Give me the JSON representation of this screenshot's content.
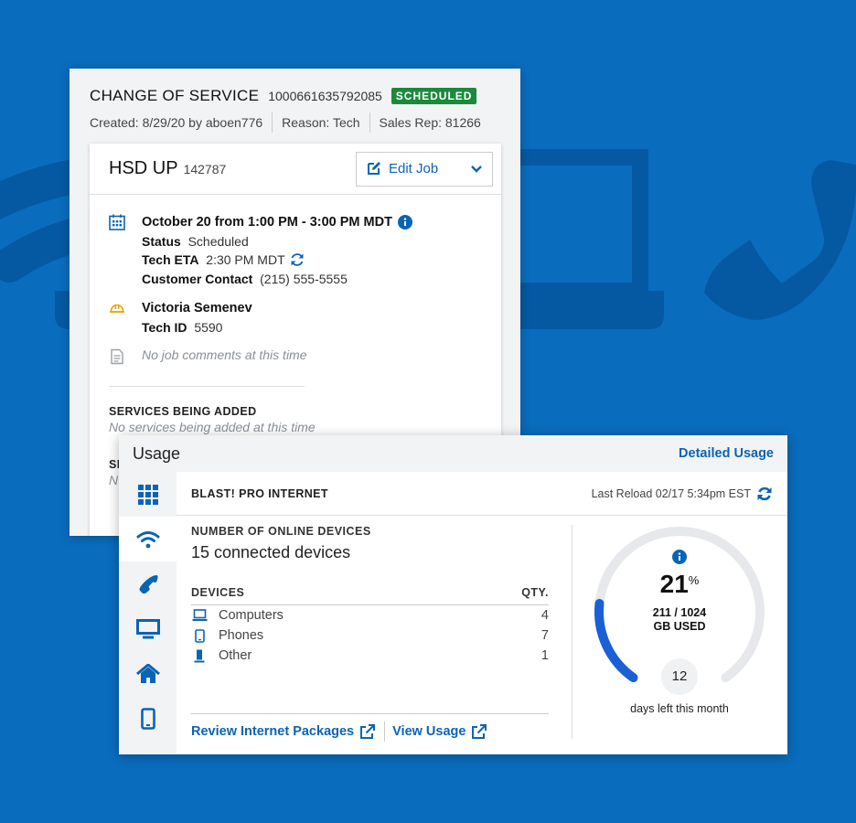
{
  "colors": {
    "background": "#0a6cbd",
    "link": "#0a64b5",
    "scheduled_badge": "#1b8a3a",
    "gauge_fill": "#1a5fd6",
    "tech_icon": "#e5a400"
  },
  "service_order": {
    "title": "CHANGE OF SERVICE",
    "order_number": "1000661635792085",
    "status_badge": "SCHEDULED",
    "created": "Created: 8/29/20 by aboen776",
    "reason": "Reason: Tech",
    "sales_rep": "Sales Rep: 81266",
    "job": {
      "title": "HSD UP",
      "number": "142787",
      "edit_label": "Edit Job",
      "appointment": "October 20 from 1:00 PM - 3:00 PM MDT",
      "status_label": "Status",
      "status_value": "Scheduled",
      "eta_label": "Tech ETA",
      "eta_value": "2:30 PM MDT",
      "contact_label": "Customer Contact",
      "contact_value": "(215) 555-5555",
      "tech_name": "Victoria Semenev",
      "tech_id_label": "Tech ID",
      "tech_id_value": "5590",
      "comments": "No job comments at this time",
      "services_added_label": "SERVICES BEING ADDED",
      "services_added_value": "No services being added at this time",
      "services_removed_label_partial": "SI",
      "services_removed_value_partial": "N"
    }
  },
  "usage": {
    "title": "Usage",
    "detailed_link": "Detailed Usage",
    "sidebar_icons": [
      "grid-icon",
      "wifi-icon",
      "phone-icon",
      "monitor-icon",
      "home-icon",
      "mobile-icon"
    ],
    "active_tab": "wifi-icon",
    "plan_name": "BLAST! PRO INTERNET",
    "last_reload": "Last Reload 02/17 5:34pm EST",
    "online_devices_label": "NUMBER OF ONLINE DEVICES",
    "online_devices_value": "15 connected devices",
    "devices_header": "DEVICES",
    "qty_header": "QTY.",
    "devices": [
      {
        "icon": "laptop-icon",
        "name": "Computers",
        "qty": "4"
      },
      {
        "icon": "smartphone-icon",
        "name": "Phones",
        "qty": "7"
      },
      {
        "icon": "other-device-icon",
        "name": "Other",
        "qty": "1"
      }
    ],
    "review_link": "Review Internet Packages",
    "view_usage_link": "View Usage",
    "gauge": {
      "percent": "21",
      "percent_symbol": "%",
      "percent_value": 21,
      "used": "211 / 1024",
      "used_label": "GB USED",
      "days_left": "12",
      "days_left_label": "days left this month"
    }
  }
}
